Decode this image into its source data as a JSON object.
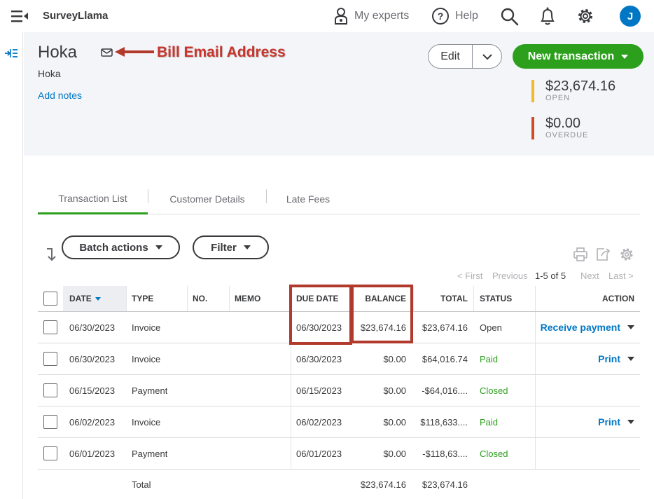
{
  "app": {
    "brand": "SurveyLlama",
    "avatar_initial": "J"
  },
  "topnav": {
    "my_experts": "My experts",
    "help": "Help"
  },
  "customer": {
    "name": "Hoka",
    "company": "Hoka",
    "add_notes": "Add notes",
    "annotation": "Bill Email Address"
  },
  "buttons": {
    "edit": "Edit",
    "new_transaction": "New transaction",
    "batch_actions": "Batch actions",
    "filter": "Filter"
  },
  "summary": {
    "open": {
      "amount": "$23,674.16",
      "label": "OPEN",
      "color": "#f2b929"
    },
    "overdue": {
      "amount": "$0.00",
      "label": "OVERDUE",
      "color": "#d04c26"
    }
  },
  "tabs": [
    "Transaction List",
    "Customer Details",
    "Late Fees"
  ],
  "pager": {
    "first": "< First",
    "previous": "Previous",
    "count": "1-5 of 5",
    "next": "Next",
    "last": "Last >"
  },
  "table": {
    "headers": {
      "date": "DATE",
      "type": "TYPE",
      "no": "NO.",
      "memo": "MEMO",
      "due_date": "DUE DATE",
      "balance": "BALANCE",
      "total": "TOTAL",
      "status": "STATUS",
      "action": "ACTION"
    },
    "rows": [
      {
        "date": "06/30/2023",
        "type": "Invoice",
        "no": "",
        "memo": "",
        "due_date": "06/30/2023",
        "balance": "$23,674.16",
        "total": "$23,674.16",
        "status": "Open",
        "action": "Receive payment"
      },
      {
        "date": "06/30/2023",
        "type": "Invoice",
        "no": "",
        "memo": "",
        "due_date": "06/30/2023",
        "balance": "$0.00",
        "total": "$64,016.74",
        "status": "Paid",
        "action": "Print"
      },
      {
        "date": "06/15/2023",
        "type": "Payment",
        "no": "",
        "memo": "",
        "due_date": "06/15/2023",
        "balance": "$0.00",
        "total": "-$64,016....",
        "status": "Closed",
        "action": ""
      },
      {
        "date": "06/02/2023",
        "type": "Invoice",
        "no": "",
        "memo": "",
        "due_date": "06/02/2023",
        "balance": "$0.00",
        "total": "$118,633....",
        "status": "Paid",
        "action": "Print"
      },
      {
        "date": "06/01/2023",
        "type": "Payment",
        "no": "",
        "memo": "",
        "due_date": "06/01/2023",
        "balance": "$0.00",
        "total": "-$118,63....",
        "status": "Closed",
        "action": ""
      }
    ],
    "totals": {
      "label": "Total",
      "balance": "$23,674.16",
      "total": "$23,674.16"
    }
  },
  "icons": {
    "menu": "menu-collapse-icon",
    "experts": "experts-icon",
    "help": "help-icon",
    "search": "search-icon",
    "bell": "notification-bell-icon",
    "gear": "gear-icon",
    "mail": "mail-icon",
    "rail": "expand-rail-icon",
    "sort": "sort-arrow-icon",
    "print": "print-icon",
    "export": "export-icon",
    "settings": "table-settings-icon"
  }
}
